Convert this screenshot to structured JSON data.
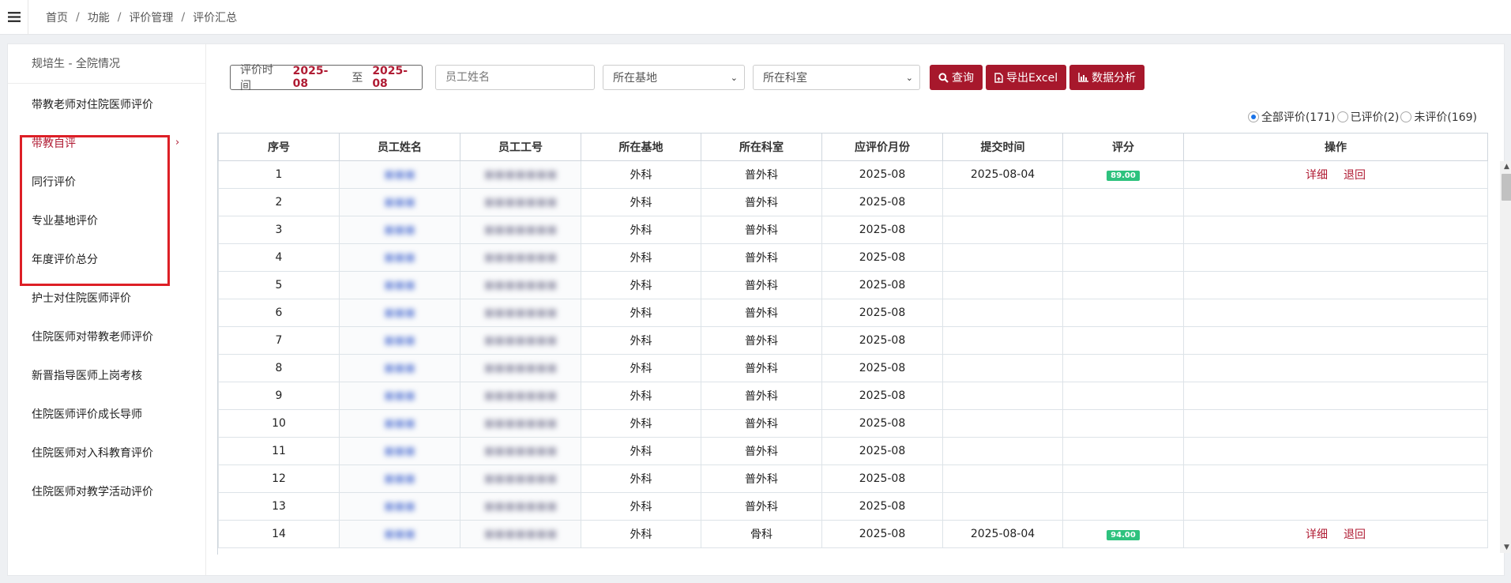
{
  "breadcrumb": [
    "首页",
    "功能",
    "评价管理",
    "评价汇总"
  ],
  "breadcrumb_sep": "/",
  "sidebar": {
    "header": "规培生 - 全院情况",
    "items": [
      {
        "label": "带教老师对住院医师评价"
      },
      {
        "label": "带教自评",
        "active": true
      },
      {
        "label": "同行评价"
      },
      {
        "label": "专业基地评价"
      },
      {
        "label": "年度评价总分"
      },
      {
        "label": "护士对住院医师评价"
      },
      {
        "label": "住院医师对带教老师评价"
      },
      {
        "label": "新晋指导医师上岗考核"
      },
      {
        "label": "住院医师评价成长导师"
      },
      {
        "label": "住院医师对入科教育评价"
      },
      {
        "label": "住院医师对教学活动评价"
      }
    ]
  },
  "filters": {
    "date_label": "评价时间",
    "date_from": "2025-08",
    "date_to_label": "至",
    "date_to": "2025-08",
    "name_placeholder": "员工姓名",
    "base_select": "所在基地",
    "dept_select": "所在科室",
    "query_label": "查询",
    "export_label": "导出Excel",
    "analysis_label": "数据分析"
  },
  "radio": {
    "all": "全部评价(171)",
    "done": "已评价(2)",
    "pending": "未评价(169)",
    "selected": "all"
  },
  "table": {
    "headers": [
      "序号",
      "员工姓名",
      "员工工号",
      "所在基地",
      "所在科室",
      "应评价月份",
      "提交时间",
      "评分",
      "操作"
    ],
    "rows": [
      {
        "no": "1",
        "name": "■■■",
        "id": "■■■■■■■",
        "base": "外科",
        "dept": "普外科",
        "month": "2025-08",
        "submit": "2025-08-04",
        "score": "89.00",
        "ops": [
          "详细",
          "退回"
        ]
      },
      {
        "no": "2",
        "name": "■■■",
        "id": "■■■■■■■",
        "base": "外科",
        "dept": "普外科",
        "month": "2025-08",
        "submit": "",
        "score": "",
        "ops": []
      },
      {
        "no": "3",
        "name": "■■■",
        "id": "■■■■■■■",
        "base": "外科",
        "dept": "普外科",
        "month": "2025-08",
        "submit": "",
        "score": "",
        "ops": []
      },
      {
        "no": "4",
        "name": "■■■",
        "id": "■■■■■■■",
        "base": "外科",
        "dept": "普外科",
        "month": "2025-08",
        "submit": "",
        "score": "",
        "ops": []
      },
      {
        "no": "5",
        "name": "■■■",
        "id": "■■■■■■■",
        "base": "外科",
        "dept": "普外科",
        "month": "2025-08",
        "submit": "",
        "score": "",
        "ops": []
      },
      {
        "no": "6",
        "name": "■■■",
        "id": "■■■■■■■",
        "base": "外科",
        "dept": "普外科",
        "month": "2025-08",
        "submit": "",
        "score": "",
        "ops": []
      },
      {
        "no": "7",
        "name": "■■■",
        "id": "■■■■■■■",
        "base": "外科",
        "dept": "普外科",
        "month": "2025-08",
        "submit": "",
        "score": "",
        "ops": []
      },
      {
        "no": "8",
        "name": "■■■",
        "id": "■■■■■■■",
        "base": "外科",
        "dept": "普外科",
        "month": "2025-08",
        "submit": "",
        "score": "",
        "ops": []
      },
      {
        "no": "9",
        "name": "■■■",
        "id": "■■■■■■■",
        "base": "外科",
        "dept": "普外科",
        "month": "2025-08",
        "submit": "",
        "score": "",
        "ops": []
      },
      {
        "no": "10",
        "name": "■■■",
        "id": "■■■■■■■",
        "base": "外科",
        "dept": "普外科",
        "month": "2025-08",
        "submit": "",
        "score": "",
        "ops": []
      },
      {
        "no": "11",
        "name": "■■■",
        "id": "■■■■■■■",
        "base": "外科",
        "dept": "普外科",
        "month": "2025-08",
        "submit": "",
        "score": "",
        "ops": []
      },
      {
        "no": "12",
        "name": "■■■",
        "id": "■■■■■■■",
        "base": "外科",
        "dept": "普外科",
        "month": "2025-08",
        "submit": "",
        "score": "",
        "ops": []
      },
      {
        "no": "13",
        "name": "■■■",
        "id": "■■■■■■■",
        "base": "外科",
        "dept": "普外科",
        "month": "2025-08",
        "submit": "",
        "score": "",
        "ops": []
      },
      {
        "no": "14",
        "name": "■■■",
        "id": "■■■■■■■",
        "base": "外科",
        "dept": "骨科",
        "month": "2025-08",
        "submit": "2025-08-04",
        "score": "94.00",
        "ops": [
          "详细",
          "退回"
        ]
      }
    ]
  },
  "colors": {
    "accent": "#a7182c",
    "score_badge": "#2ec27e",
    "highlight_box": "#dd1f26",
    "radio_selected": "#1a73e8"
  }
}
